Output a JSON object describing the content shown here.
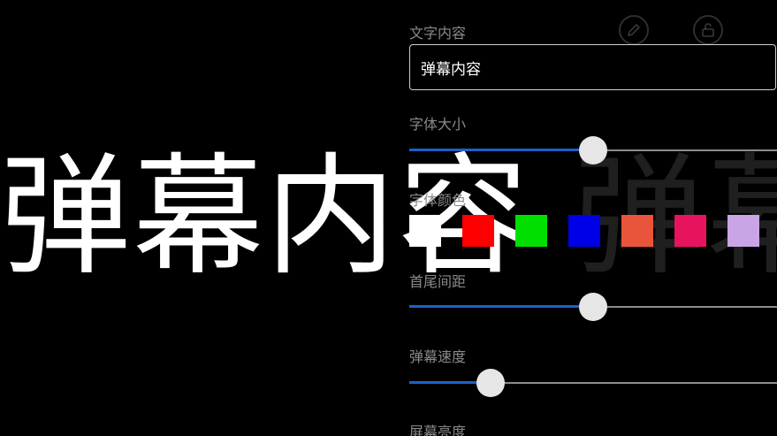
{
  "danmaku": {
    "text": "弹幕内容",
    "ghost_text": "容 弹幕"
  },
  "toolbar": {
    "icons": [
      "pencil-icon",
      "lock-icon"
    ]
  },
  "panel": {
    "text_content": {
      "label": "文字内容",
      "value": "弹幕内容"
    },
    "font_size": {
      "label": "字体大小",
      "value_fraction": 0.5
    },
    "font_color": {
      "label": "字体颜色",
      "colors": [
        "#ffffff",
        "#ff0000",
        "#00e000",
        "#0000e6",
        "#e8553a",
        "#e8135f",
        "#c9a5e6"
      ],
      "selected_index": 0
    },
    "spacing": {
      "label": "首尾间距",
      "value_fraction": 0.5
    },
    "speed": {
      "label": "弹幕速度",
      "value_fraction": 0.22
    },
    "brightness": {
      "label": "屏幕亮度"
    }
  }
}
